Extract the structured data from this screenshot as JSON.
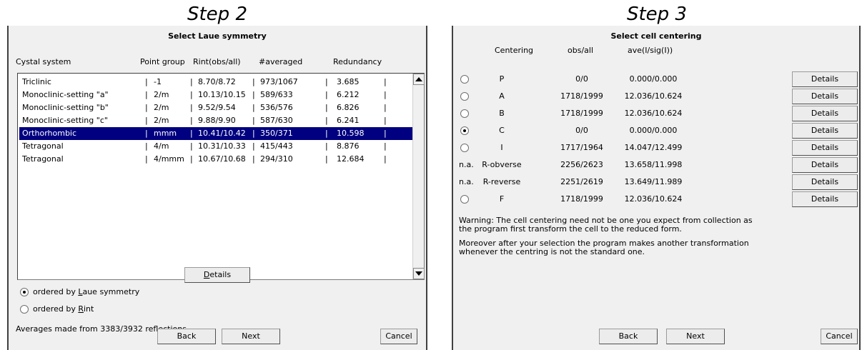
{
  "step2": {
    "heading": "Step 2",
    "title": "Select Laue symmetry",
    "headers": {
      "system": "Cystal system",
      "point_group": "Point group",
      "rint": "Rint(obs/all)",
      "averaged": "#averaged",
      "redundancy": "Redundancy"
    },
    "rows": [
      {
        "system": "Triclinic",
        "pg": "-1",
        "rint": "8.70/8.72",
        "avg": "973/1067",
        "red": "3.685",
        "selected": false
      },
      {
        "system": "Monoclinic-setting \"a\"",
        "pg": "2/m",
        "rint": "10.13/10.15",
        "avg": "589/633",
        "red": "6.212",
        "selected": false
      },
      {
        "system": "Monoclinic-setting \"b\"",
        "pg": "2/m",
        "rint": "9.52/9.54",
        "avg": "536/576",
        "red": "6.826",
        "selected": false
      },
      {
        "system": "Monoclinic-setting \"c\"",
        "pg": "2/m",
        "rint": "9.88/9.90",
        "avg": "587/630",
        "red": "6.241",
        "selected": false
      },
      {
        "system": "Orthorhombic",
        "pg": "mmm",
        "rint": "10.41/10.42",
        "avg": "350/371",
        "red": "10.598",
        "selected": true
      },
      {
        "system": "Tetragonal",
        "pg": "4/m",
        "rint": "10.31/10.33",
        "avg": "415/443",
        "red": "8.876",
        "selected": false
      },
      {
        "system": "Tetragonal",
        "pg": "4/mmm",
        "rint": "10.67/10.68",
        "avg": "294/310",
        "red": "12.684",
        "selected": false
      }
    ],
    "sep": "|",
    "radio_laue": {
      "pre": "ordered by ",
      "key": "L",
      "post": "aue symmetry",
      "checked": true
    },
    "radio_rint": {
      "pre": "ordered by ",
      "key": "R",
      "post": "int",
      "checked": false
    },
    "details": {
      "key": "D",
      "post": "etails"
    },
    "averages_text": "Averages made from 3383/3932 reflections",
    "back": "Back",
    "next": "Next",
    "cancel": "Cancel"
  },
  "step3": {
    "heading": "Step 3",
    "title": "Select cell centering",
    "headers": {
      "centering": "Centering",
      "obs": "obs/all",
      "ave": "ave(I/sig(I))"
    },
    "rows": [
      {
        "prefix": "",
        "radio": true,
        "checked": false,
        "centering": "P",
        "obs": "0/0",
        "ave": "0.000/0.000",
        "details": "Details"
      },
      {
        "prefix": "",
        "radio": true,
        "checked": false,
        "centering": "A",
        "obs": "1718/1999",
        "ave": "12.036/10.624",
        "details": "Details"
      },
      {
        "prefix": "",
        "radio": true,
        "checked": false,
        "centering": "B",
        "obs": "1718/1999",
        "ave": "12.036/10.624",
        "details": "Details"
      },
      {
        "prefix": "",
        "radio": true,
        "checked": true,
        "centering": "C",
        "obs": "0/0",
        "ave": "0.000/0.000",
        "details": "Details"
      },
      {
        "prefix": "",
        "radio": true,
        "checked": false,
        "centering": "I",
        "obs": "1717/1964",
        "ave": "14.047/12.499",
        "details": "Details"
      },
      {
        "prefix": "n.a.",
        "radio": false,
        "checked": false,
        "centering": "R-obverse",
        "obs": "2256/2623",
        "ave": "13.658/11.998",
        "details": "Details"
      },
      {
        "prefix": "n.a.",
        "radio": false,
        "checked": false,
        "centering": "R-reverse",
        "obs": "2251/2619",
        "ave": "13.649/11.989",
        "details": "Details"
      },
      {
        "prefix": "",
        "radio": true,
        "checked": false,
        "centering": "F",
        "obs": "1718/1999",
        "ave": "12.036/10.624",
        "details": "Details"
      }
    ],
    "warning1": "Warning: The cell centering need not be one you expect from collection as",
    "warning2": "the program first transform the cell to the reduced form.",
    "note1": "Moreover after your selection the program makes another transformation",
    "note2": "whenever the centring is not the standard one.",
    "back": "Back",
    "next": "Next",
    "cancel": "Cancel"
  }
}
